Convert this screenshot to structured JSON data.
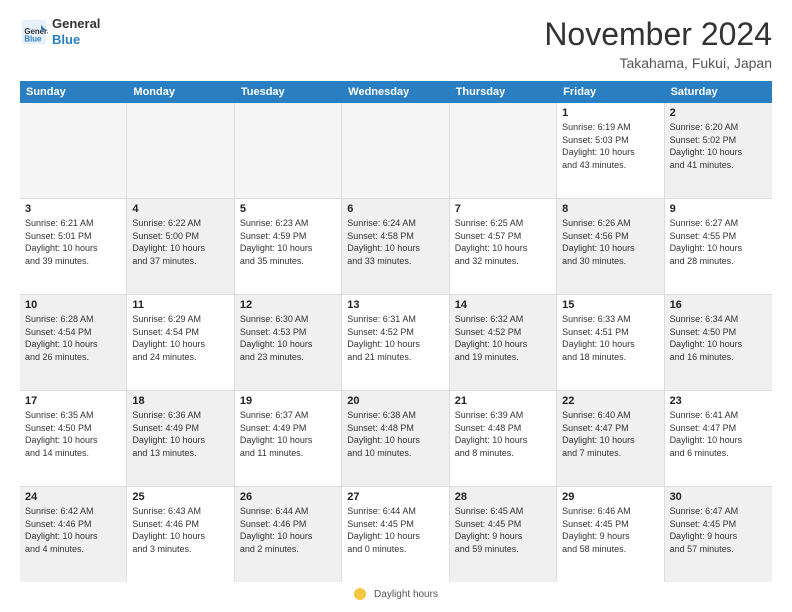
{
  "header": {
    "logo_line1": "General",
    "logo_line2": "Blue",
    "month_title": "November 2024",
    "location": "Takahama, Fukui, Japan"
  },
  "days_of_week": [
    "Sunday",
    "Monday",
    "Tuesday",
    "Wednesday",
    "Thursday",
    "Friday",
    "Saturday"
  ],
  "legend_label": "Daylight hours",
  "rows": [
    [
      {
        "day": "",
        "info": "",
        "empty": true
      },
      {
        "day": "",
        "info": "",
        "empty": true
      },
      {
        "day": "",
        "info": "",
        "empty": true
      },
      {
        "day": "",
        "info": "",
        "empty": true
      },
      {
        "day": "",
        "info": "",
        "empty": true
      },
      {
        "day": "1",
        "info": "Sunrise: 6:19 AM\nSunset: 5:03 PM\nDaylight: 10 hours\nand 43 minutes.",
        "empty": false
      },
      {
        "day": "2",
        "info": "Sunrise: 6:20 AM\nSunset: 5:02 PM\nDaylight: 10 hours\nand 41 minutes.",
        "empty": false,
        "shaded": true
      }
    ],
    [
      {
        "day": "3",
        "info": "Sunrise: 6:21 AM\nSunset: 5:01 PM\nDaylight: 10 hours\nand 39 minutes.",
        "empty": false
      },
      {
        "day": "4",
        "info": "Sunrise: 6:22 AM\nSunset: 5:00 PM\nDaylight: 10 hours\nand 37 minutes.",
        "empty": false,
        "shaded": true
      },
      {
        "day": "5",
        "info": "Sunrise: 6:23 AM\nSunset: 4:59 PM\nDaylight: 10 hours\nand 35 minutes.",
        "empty": false
      },
      {
        "day": "6",
        "info": "Sunrise: 6:24 AM\nSunset: 4:58 PM\nDaylight: 10 hours\nand 33 minutes.",
        "empty": false,
        "shaded": true
      },
      {
        "day": "7",
        "info": "Sunrise: 6:25 AM\nSunset: 4:57 PM\nDaylight: 10 hours\nand 32 minutes.",
        "empty": false
      },
      {
        "day": "8",
        "info": "Sunrise: 6:26 AM\nSunset: 4:56 PM\nDaylight: 10 hours\nand 30 minutes.",
        "empty": false,
        "shaded": true
      },
      {
        "day": "9",
        "info": "Sunrise: 6:27 AM\nSunset: 4:55 PM\nDaylight: 10 hours\nand 28 minutes.",
        "empty": false
      }
    ],
    [
      {
        "day": "10",
        "info": "Sunrise: 6:28 AM\nSunset: 4:54 PM\nDaylight: 10 hours\nand 26 minutes.",
        "empty": false,
        "shaded": true
      },
      {
        "day": "11",
        "info": "Sunrise: 6:29 AM\nSunset: 4:54 PM\nDaylight: 10 hours\nand 24 minutes.",
        "empty": false
      },
      {
        "day": "12",
        "info": "Sunrise: 6:30 AM\nSunset: 4:53 PM\nDaylight: 10 hours\nand 23 minutes.",
        "empty": false,
        "shaded": true
      },
      {
        "day": "13",
        "info": "Sunrise: 6:31 AM\nSunset: 4:52 PM\nDaylight: 10 hours\nand 21 minutes.",
        "empty": false
      },
      {
        "day": "14",
        "info": "Sunrise: 6:32 AM\nSunset: 4:52 PM\nDaylight: 10 hours\nand 19 minutes.",
        "empty": false,
        "shaded": true
      },
      {
        "day": "15",
        "info": "Sunrise: 6:33 AM\nSunset: 4:51 PM\nDaylight: 10 hours\nand 18 minutes.",
        "empty": false
      },
      {
        "day": "16",
        "info": "Sunrise: 6:34 AM\nSunset: 4:50 PM\nDaylight: 10 hours\nand 16 minutes.",
        "empty": false,
        "shaded": true
      }
    ],
    [
      {
        "day": "17",
        "info": "Sunrise: 6:35 AM\nSunset: 4:50 PM\nDaylight: 10 hours\nand 14 minutes.",
        "empty": false
      },
      {
        "day": "18",
        "info": "Sunrise: 6:36 AM\nSunset: 4:49 PM\nDaylight: 10 hours\nand 13 minutes.",
        "empty": false,
        "shaded": true
      },
      {
        "day": "19",
        "info": "Sunrise: 6:37 AM\nSunset: 4:49 PM\nDaylight: 10 hours\nand 11 minutes.",
        "empty": false
      },
      {
        "day": "20",
        "info": "Sunrise: 6:38 AM\nSunset: 4:48 PM\nDaylight: 10 hours\nand 10 minutes.",
        "empty": false,
        "shaded": true
      },
      {
        "day": "21",
        "info": "Sunrise: 6:39 AM\nSunset: 4:48 PM\nDaylight: 10 hours\nand 8 minutes.",
        "empty": false
      },
      {
        "day": "22",
        "info": "Sunrise: 6:40 AM\nSunset: 4:47 PM\nDaylight: 10 hours\nand 7 minutes.",
        "empty": false,
        "shaded": true
      },
      {
        "day": "23",
        "info": "Sunrise: 6:41 AM\nSunset: 4:47 PM\nDaylight: 10 hours\nand 6 minutes.",
        "empty": false
      }
    ],
    [
      {
        "day": "24",
        "info": "Sunrise: 6:42 AM\nSunset: 4:46 PM\nDaylight: 10 hours\nand 4 minutes.",
        "empty": false,
        "shaded": true
      },
      {
        "day": "25",
        "info": "Sunrise: 6:43 AM\nSunset: 4:46 PM\nDaylight: 10 hours\nand 3 minutes.",
        "empty": false
      },
      {
        "day": "26",
        "info": "Sunrise: 6:44 AM\nSunset: 4:46 PM\nDaylight: 10 hours\nand 2 minutes.",
        "empty": false,
        "shaded": true
      },
      {
        "day": "27",
        "info": "Sunrise: 6:44 AM\nSunset: 4:45 PM\nDaylight: 10 hours\nand 0 minutes.",
        "empty": false
      },
      {
        "day": "28",
        "info": "Sunrise: 6:45 AM\nSunset: 4:45 PM\nDaylight: 9 hours\nand 59 minutes.",
        "empty": false,
        "shaded": true
      },
      {
        "day": "29",
        "info": "Sunrise: 6:46 AM\nSunset: 4:45 PM\nDaylight: 9 hours\nand 58 minutes.",
        "empty": false
      },
      {
        "day": "30",
        "info": "Sunrise: 6:47 AM\nSunset: 4:45 PM\nDaylight: 9 hours\nand 57 minutes.",
        "empty": false,
        "shaded": true
      }
    ]
  ]
}
